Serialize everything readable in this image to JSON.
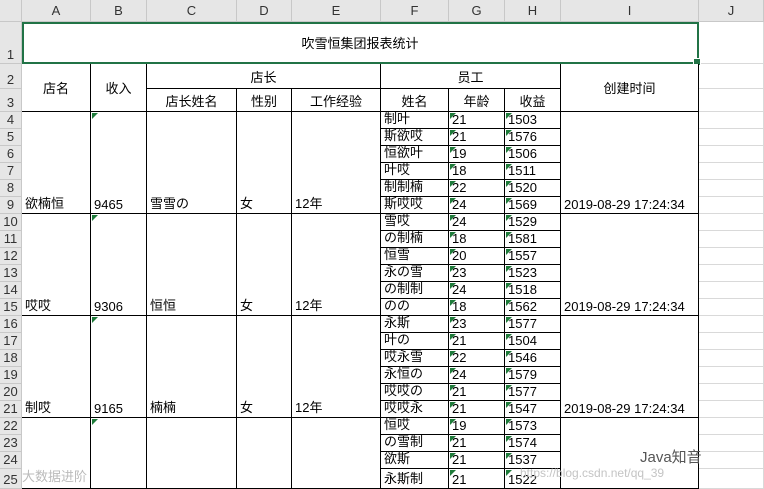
{
  "columns": [
    "A",
    "B",
    "C",
    "D",
    "E",
    "F",
    "G",
    "H",
    "I",
    "J"
  ],
  "rows": [
    "1",
    "2",
    "3",
    "4",
    "5",
    "6",
    "7",
    "8",
    "9",
    "10",
    "11",
    "12",
    "13",
    "14",
    "15",
    "16",
    "17",
    "18",
    "19",
    "20",
    "21",
    "22",
    "23",
    "24",
    "25"
  ],
  "title": "吹雪恒集团报表统计",
  "headers": {
    "store_name": "店名",
    "revenue": "收入",
    "manager": "店长",
    "employee": "员工",
    "created": "创建时间",
    "manager_name": "店长姓名",
    "gender": "性别",
    "experience": "工作经验",
    "emp_name": "姓名",
    "age": "年龄",
    "income": "收益"
  },
  "stores": [
    {
      "name": "欲楠恒",
      "revenue": "9465",
      "manager": "雪雪の",
      "gender": "女",
      "experience": "12年",
      "created": "2019-08-29 17:24:34"
    },
    {
      "name": "哎哎",
      "revenue": "9306",
      "manager": "恒恒",
      "gender": "女",
      "experience": "12年",
      "created": "2019-08-29 17:24:34"
    },
    {
      "name": "制哎",
      "revenue": "9165",
      "manager": "楠楠",
      "gender": "女",
      "experience": "12年",
      "created": "2019-08-29 17:24:34"
    }
  ],
  "employees": [
    {
      "name": "制叶",
      "age": "21",
      "income": "1503"
    },
    {
      "name": "斯欲哎",
      "age": "21",
      "income": "1576"
    },
    {
      "name": "恒欲叶",
      "age": "19",
      "income": "1506"
    },
    {
      "name": "叶哎",
      "age": "18",
      "income": "1511"
    },
    {
      "name": "制制楠",
      "age": "22",
      "income": "1520"
    },
    {
      "name": "斯哎哎",
      "age": "24",
      "income": "1569"
    },
    {
      "name": "雪哎",
      "age": "24",
      "income": "1529"
    },
    {
      "name": "の制楠",
      "age": "18",
      "income": "1581"
    },
    {
      "name": "恒雪",
      "age": "20",
      "income": "1557"
    },
    {
      "name": "永の雪",
      "age": "23",
      "income": "1523"
    },
    {
      "name": "の制制",
      "age": "24",
      "income": "1518"
    },
    {
      "name": "のの",
      "age": "18",
      "income": "1562"
    },
    {
      "name": "永斯",
      "age": "23",
      "income": "1577"
    },
    {
      "name": "叶の",
      "age": "21",
      "income": "1504"
    },
    {
      "name": "哎永雪",
      "age": "22",
      "income": "1546"
    },
    {
      "name": "永恒の",
      "age": "24",
      "income": "1579"
    },
    {
      "name": "哎哎の",
      "age": "21",
      "income": "1577"
    },
    {
      "name": "哎哎永",
      "age": "21",
      "income": "1547"
    },
    {
      "name": "恒哎",
      "age": "19",
      "income": "1573"
    },
    {
      "name": "の雪制",
      "age": "21",
      "income": "1574"
    },
    {
      "name": "欲斯",
      "age": "21",
      "income": "1537"
    },
    {
      "name": "永斯制",
      "age": "21",
      "income": "1522"
    }
  ],
  "watermarks": {
    "left": "大数据进阶",
    "url": "https://blog.csdn.net/qq_39",
    "brand": "Java知音"
  }
}
